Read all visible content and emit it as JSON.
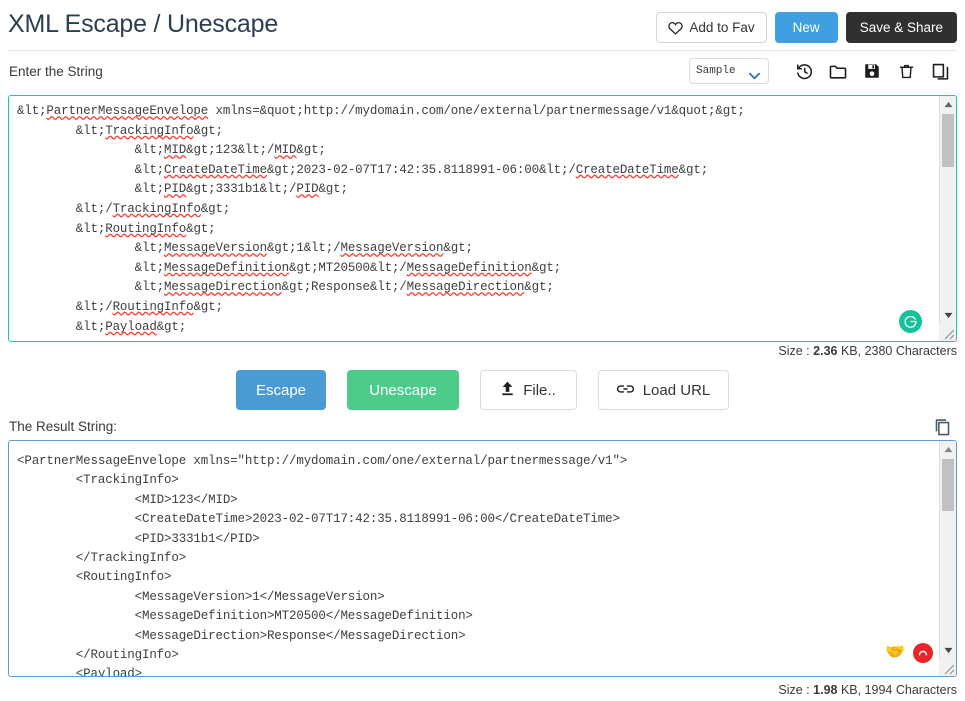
{
  "header": {
    "title": "XML Escape / Unescape",
    "add_to_fav_label": "Add to Fav",
    "new_label": "New",
    "save_share_label": "Save & Share"
  },
  "toolbar": {
    "enter_label": "Enter the String",
    "sample_option": "Sample",
    "icons": [
      "history-icon",
      "folder-open-icon",
      "save-disk-icon",
      "trash-icon",
      "copy-icon"
    ]
  },
  "input": {
    "content": "&lt;PartnerMessageEnvelope xmlns=&quot;http://mydomain.com/one/external/partnermessage/v1&quot;&gt;\n        &lt;TrackingInfo&gt;\n                &lt;MID&gt;123&lt;/MID&gt;\n                &lt;CreateDateTime&gt;2023-02-07T17:42:35.8118991-06:00&lt;/CreateDateTime&gt;\n                &lt;PID&gt;3331b1&lt;/PID&gt;\n        &lt;/TrackingInfo&gt;\n        &lt;RoutingInfo&gt;\n                &lt;MessageVersion&gt;1&lt;/MessageVersion&gt;\n                &lt;MessageDefinition&gt;MT20500&lt;/MessageDefinition&gt;\n                &lt;MessageDirection&gt;Response&lt;/MessageDirection&gt;\n        &lt;/RoutingInfo&gt;\n        &lt;Payload&gt;",
    "size_prefix": "Size : ",
    "size_value": "2.36",
    "size_suffix": " KB, 2380 Characters",
    "grammarly_glyph": "G"
  },
  "actions": {
    "escape_label": "Escape",
    "unescape_label": "Unescape",
    "file_label": "File..",
    "load_url_label": "Load URL"
  },
  "result": {
    "label": "The Result String:",
    "content": "<PartnerMessageEnvelope xmlns=\"http://mydomain.com/one/external/partnermessage/v1\">\n        <TrackingInfo>\n                <MID>123</MID>\n                <CreateDateTime>2023-02-07T17:42:35.8118991-06:00</CreateDateTime>\n                <PID>3331b1</PID>\n        </TrackingInfo>\n        <RoutingInfo>\n                <MessageVersion>1</MessageVersion>\n                <MessageDefinition>MT20500</MessageDefinition>\n                <MessageDirection>Response</MessageDirection>\n        </RoutingInfo>\n        <Payload>",
    "size_prefix": "Size : ",
    "size_value": "1.98",
    "size_suffix": " KB, 1994 Characters",
    "handshake_glyph": "🤝"
  },
  "colors": {
    "accent_blue": "#3f9fe0",
    "dark_button": "#303030",
    "input_border_teal": "#1bc6a4",
    "result_border_blue": "#5b9bd5",
    "escape_blue": "#4a9ad4",
    "unescape_green": "#4ccb8b",
    "grammarly_green": "#15c39a",
    "red_dot": "#e8262a"
  }
}
